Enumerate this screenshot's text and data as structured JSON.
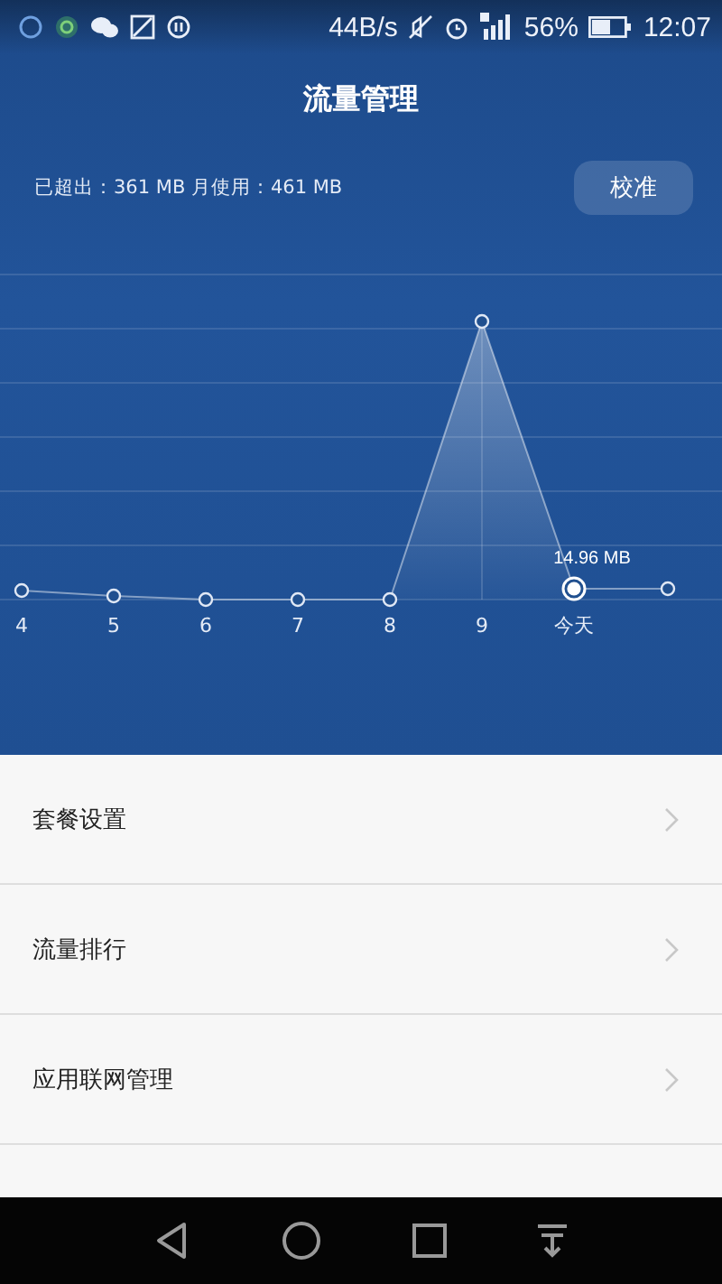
{
  "status_bar": {
    "speed": "44B/s",
    "battery": "56%",
    "time": "12:07"
  },
  "title": "流量管理",
  "usage_summary": "已超出：361 MB 月使用：461 MB",
  "calibrate_button": "校准",
  "chart": {
    "day_labels": [
      "4",
      "5",
      "6",
      "7",
      "8",
      "9",
      "今天"
    ],
    "value_label": "14.96 MB"
  },
  "menu_items": [
    {
      "label": "套餐设置"
    },
    {
      "label": "流量排行"
    },
    {
      "label": "应用联网管理"
    }
  ]
}
